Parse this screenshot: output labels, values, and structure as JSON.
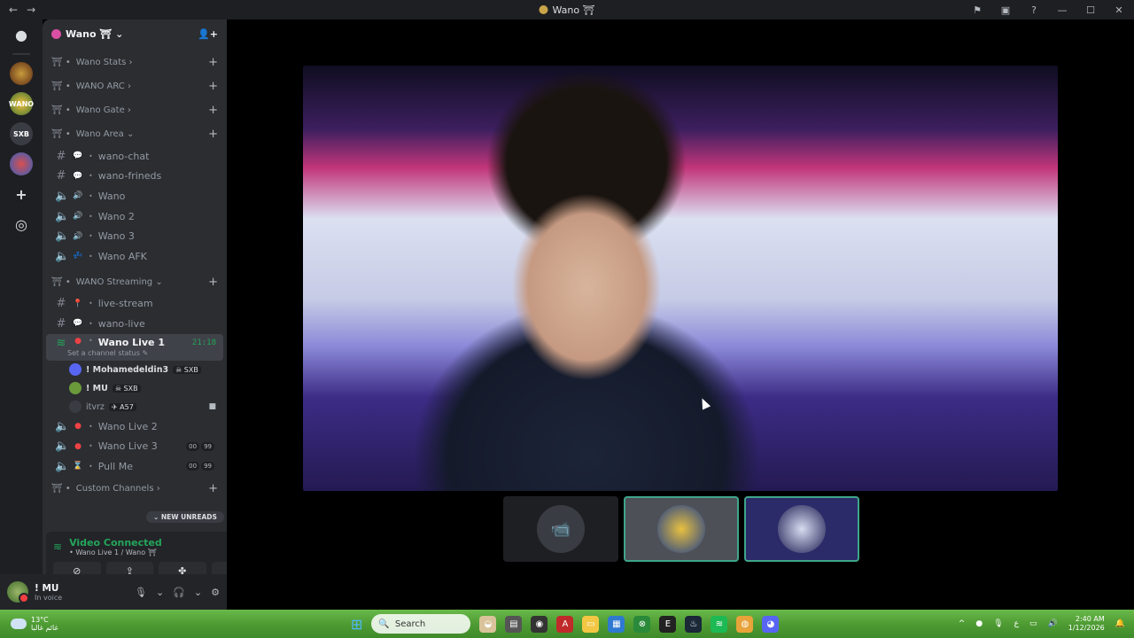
{
  "window": {
    "title": "Wano ⛩",
    "back_icon": "←",
    "forward_icon": "→",
    "controls": [
      "⚑",
      "▣",
      "?",
      "—",
      "☐",
      "✕"
    ]
  },
  "rail": {
    "discord_icon": "●",
    "servers": [
      "",
      "WANO",
      "SXB",
      ""
    ],
    "add_icon": "+",
    "explore_icon": "◎"
  },
  "server": {
    "name": "Wano ⛩ ⌄",
    "add_member_icon": "👤+"
  },
  "categories": {
    "stats": "Wano Stats ›",
    "arc": "WANO ARC ›",
    "gate": "Wano Gate ›",
    "area": "Wano Area ⌄",
    "streaming": "WANO Streaming ⌄",
    "custom": "Custom Channels ›"
  },
  "channels": {
    "wano_chat": "wano-chat",
    "wano_frineds": "wano-frineds",
    "wano": "Wano",
    "wano2": "Wano 2",
    "wano3": "Wano 3",
    "wano_afk": "Wano AFK",
    "live_stream": "live-stream",
    "wano_live": "wano-live",
    "wano_live1": "Wano Live 1",
    "wano_live1_timer": "21:18",
    "wano_live1_status": "Set a channel status ✎",
    "wano_live2": "Wano Live 2",
    "wano_live3": "Wano Live 3",
    "pull_me": "Pull Me",
    "badge_a": "00",
    "badge_b": "99"
  },
  "voice_users": [
    {
      "name": "! Mohamedeldin3",
      "tag": "☠ SXB"
    },
    {
      "name": "! MU",
      "tag": "☠ SXB"
    },
    {
      "name": "itvrz",
      "tag": "✈ A57"
    }
  ],
  "new_unreads": "⌄ NEW UNREADS",
  "voice_panel": {
    "status": "Video Connected",
    "location": "• Wano Live 1 / Wano ⛩",
    "buttons": [
      "⊘",
      "⇪",
      "✤",
      "✺"
    ]
  },
  "user": {
    "name": "! MU",
    "status": "In voice"
  },
  "tiles": [
    {
      "label": "📹"
    },
    {
      "label": ""
    },
    {
      "label": ""
    }
  ],
  "taskbar": {
    "temp": "13°C",
    "weather_desc": "غائم غالبا",
    "search": "Search",
    "time": "2:40 AM",
    "date": "1/12/2026",
    "lang": "ع"
  }
}
